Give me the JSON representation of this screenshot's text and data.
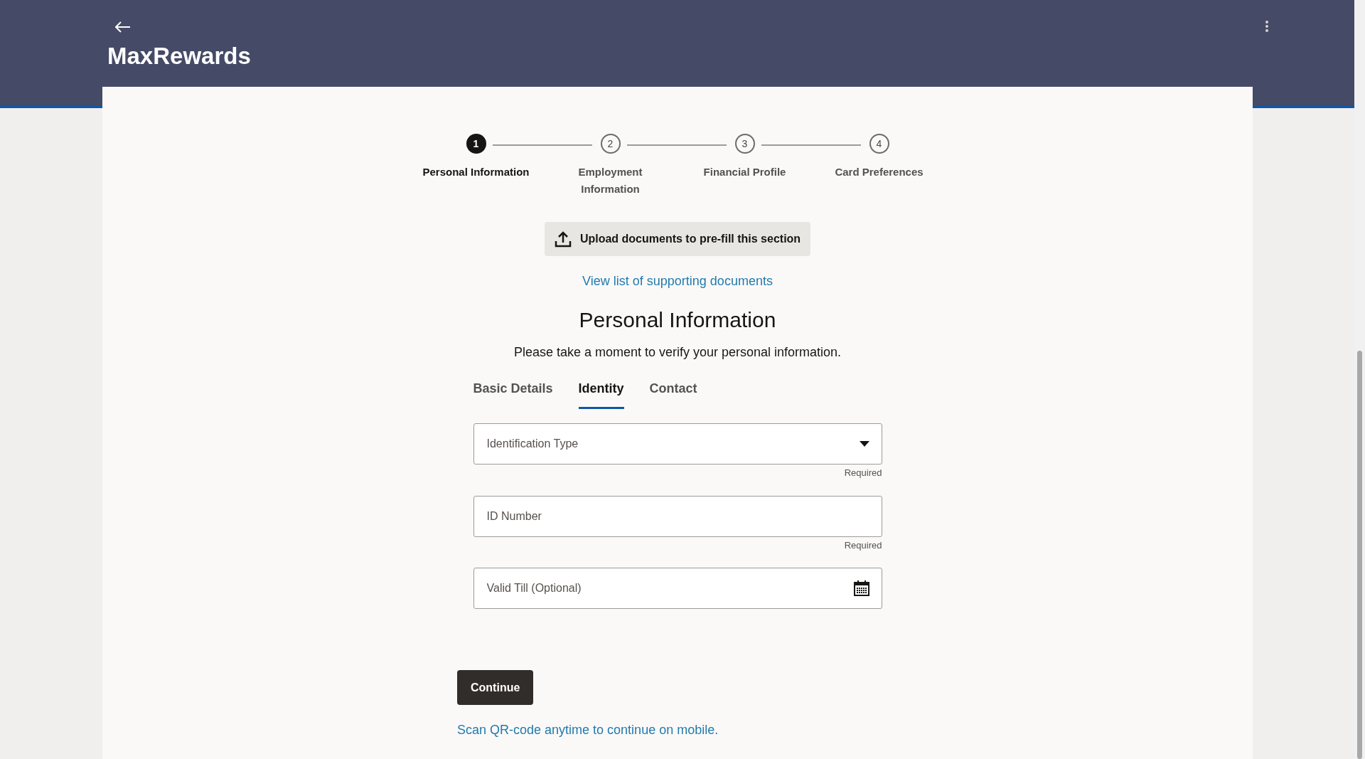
{
  "header": {
    "title": "MaxRewards"
  },
  "steps": [
    {
      "number": "1",
      "label": "Personal Information",
      "selected": true
    },
    {
      "number": "2",
      "label": "Employment Information",
      "selected": false
    },
    {
      "number": "3",
      "label": "Financial Profile",
      "selected": false
    },
    {
      "number": "4",
      "label": "Card Preferences",
      "selected": false
    }
  ],
  "upload_button": "Upload documents to pre-fill this section",
  "documents_link": "View list of supporting documents",
  "section": {
    "title": "Personal Information",
    "subtitle": "Please take a moment to verify your personal information."
  },
  "tabs": [
    {
      "label": "Basic Details",
      "selected": false
    },
    {
      "label": "Identity",
      "selected": true
    },
    {
      "label": "Contact",
      "selected": false
    }
  ],
  "fields": [
    {
      "kind": "select",
      "placeholder": "Identification Type",
      "hint": "Required"
    },
    {
      "kind": "text",
      "placeholder": "ID Number",
      "hint": "Required"
    },
    {
      "kind": "date",
      "placeholder": "Valid Till (Optional)"
    }
  ],
  "continue_button": "Continue",
  "qr_link": "Scan QR-code anytime to continue on mobile."
}
